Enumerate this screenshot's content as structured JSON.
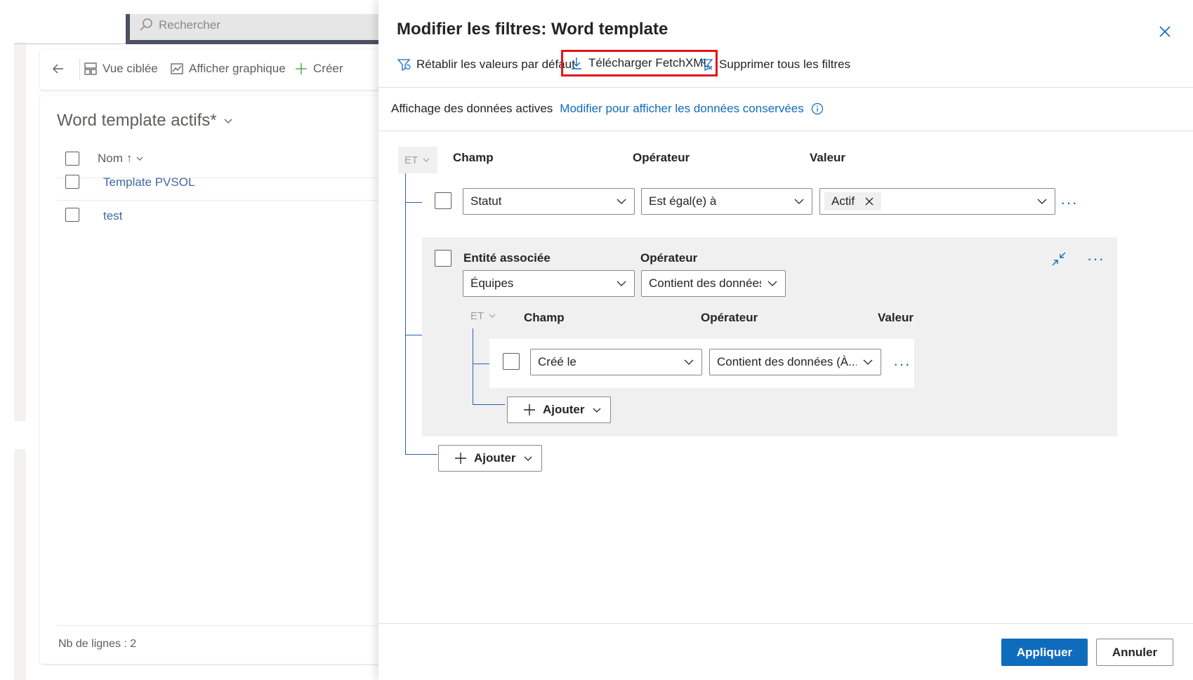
{
  "background": {
    "search_placeholder": "Rechercher",
    "command_bar": {
      "focused_view": "Vue ciblée",
      "show_chart": "Afficher graphique",
      "create": "Créer"
    },
    "view_title": "Word template actifs*",
    "grid": {
      "column_name": "Nom",
      "sort_indicator": "↑",
      "rows": [
        "Template PVSOL",
        "test"
      ]
    },
    "footer": "Nb de lignes : 2"
  },
  "panel": {
    "title": "Modifier les filtres: Word template",
    "toolbar": {
      "reset": "Rétablir les valeurs par défaut",
      "download": "Télécharger FetchXML",
      "clear_all": "Supprimer tous les filtres"
    },
    "info": {
      "text": "Affichage des données actives",
      "link": "Modifier pour afficher les données conservées"
    },
    "root_group": {
      "logic": "ET",
      "headers": {
        "field": "Champ",
        "operator": "Opérateur",
        "value": "Valeur"
      },
      "row1": {
        "field": "Statut",
        "operator": "Est égal(e) à",
        "value_tag": "Actif"
      },
      "related": {
        "entity_label": "Entité associée",
        "operator_label": "Opérateur",
        "entity": "Équipes",
        "operator": "Contient des données",
        "sub_group": {
          "logic": "ET",
          "headers": {
            "field": "Champ",
            "operator": "Opérateur",
            "value": "Valeur"
          },
          "row": {
            "field": "Créé le",
            "operator": "Contient des données (À..."
          }
        },
        "add_label": "Ajouter"
      },
      "add_label": "Ajouter"
    },
    "actions": {
      "apply": "Appliquer",
      "cancel": "Annuler"
    }
  },
  "colors": {
    "accent": "#0f6cbd",
    "highlight_border": "#e3151a",
    "tree_line": "#2b5fb4",
    "group_bg": "#f0f0f0"
  }
}
